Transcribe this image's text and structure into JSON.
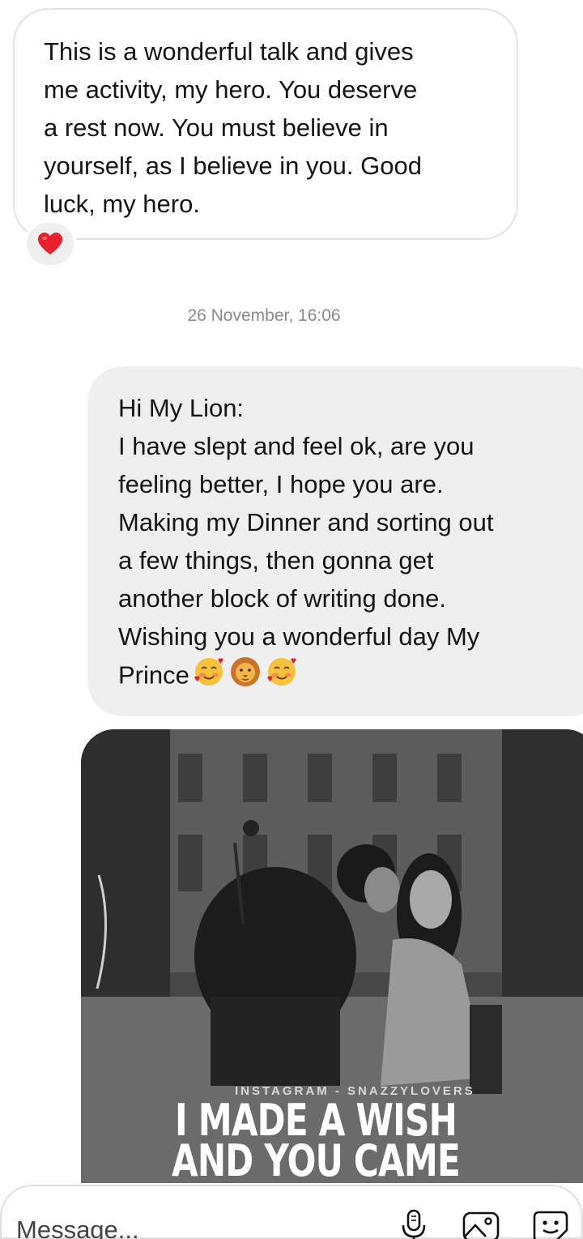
{
  "incoming_message": {
    "lines": [
      "This is a wonderful talk and gives",
      "me activity, my hero. You deserve",
      "a rest now. You must believe in",
      "yourself, as I believe in you. Good",
      "luck, my hero."
    ],
    "reaction_icon": "red-heart-emoji"
  },
  "timestamp": "26 November, 16:06",
  "outgoing_message": {
    "lines": [
      "Hi My Lion:",
      "I have slept and feel ok, are you",
      "feeling better, I hope you are.",
      "Making my Dinner and sorting out",
      "a few things, then gonna get",
      "another block of writing done.",
      "Wishing you a wonderful day My",
      "Prince"
    ],
    "emojis": [
      "smiling-face-with-hearts-emoji",
      "lion-face-emoji",
      "smiling-face-with-hearts-emoji"
    ]
  },
  "image_message": {
    "credit": "INSTAGRAM - SNAZZYLOVERS",
    "caption_line1": "I MADE A WISH",
    "caption_line2": "AND YOU CAME TRUE"
  },
  "composer": {
    "placeholder": "Message...",
    "icons": [
      "microphone-icon",
      "gallery-icon",
      "sticker-icon"
    ]
  },
  "colors": {
    "incoming_bubble_border": "#e3e3e3",
    "outgoing_bubble_bg": "#efefef",
    "heart": "#e8202e",
    "timestamp_text": "#8a8a8a"
  }
}
